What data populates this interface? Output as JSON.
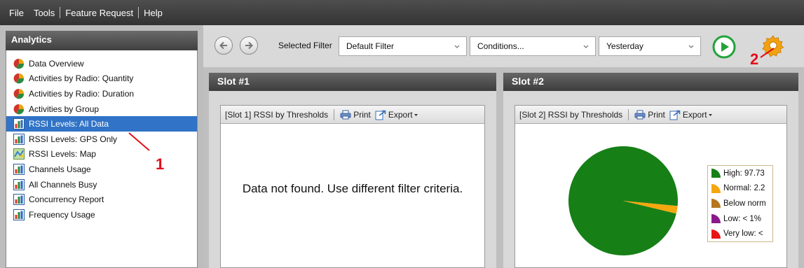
{
  "menubar": {
    "items": [
      "File",
      "Tools",
      "Feature Request",
      "Help"
    ]
  },
  "sidebar": {
    "title": "Analytics",
    "items": [
      {
        "label": "Data Overview",
        "icon": "pie-chart-icon"
      },
      {
        "label": "Activities by Radio: Quantity",
        "icon": "pie-chart-icon"
      },
      {
        "label": "Activities by Radio: Duration",
        "icon": "pie-chart-icon"
      },
      {
        "label": "Activities by Group",
        "icon": "pie-chart-icon"
      },
      {
        "label": "RSSI Levels: All Data",
        "icon": "bar-chart-icon",
        "selected": true
      },
      {
        "label": "RSSI Levels: GPS Only",
        "icon": "bar-chart-icon"
      },
      {
        "label": "RSSI Levels: Map",
        "icon": "map-icon"
      },
      {
        "label": "Channels Usage",
        "icon": "bar-chart-icon"
      },
      {
        "label": "All Channels Busy",
        "icon": "bar-chart-icon"
      },
      {
        "label": "Concurrency Report",
        "icon": "bar-chart-icon"
      },
      {
        "label": "Frequency Usage",
        "icon": "bar-chart-icon"
      }
    ]
  },
  "toolbar": {
    "back_icon": "back-arrow-icon",
    "forward_icon": "forward-arrow-icon",
    "selected_filter_label": "Selected Filter",
    "filter_value": "Default Filter",
    "conditions_value": "Conditions...",
    "date_value": "Yesterday",
    "run_icon": "play-icon",
    "settings_icon": "gear-icon"
  },
  "slots": [
    {
      "header": "Slot #1",
      "panel_title": "[Slot 1] RSSI by Thresholds",
      "print_label": "Print",
      "export_label": "Export",
      "message": "Data not found. Use different filter criteria."
    },
    {
      "header": "Slot #2",
      "panel_title": "[Slot 2] RSSI by Thresholds",
      "print_label": "Print",
      "export_label": "Export",
      "legend": [
        {
          "label": "High: 97.73",
          "color": "#168016"
        },
        {
          "label": "Normal: 2.2",
          "color": "#f5a70e"
        },
        {
          "label": "Below norm",
          "color": "#b5761f"
        },
        {
          "label": "Low: < 1%",
          "color": "#8a1a8c"
        },
        {
          "label": "Very low: <",
          "color": "#e81515"
        }
      ]
    }
  ],
  "chart_data": {
    "type": "pie",
    "categories": [
      "High",
      "Normal",
      "Below normal",
      "Low",
      "Very low"
    ],
    "values": [
      97.73,
      2.27,
      0,
      0,
      0
    ],
    "colors": [
      "#168016",
      "#f5a70e",
      "#b5761f",
      "#8a1a8c",
      "#e81515"
    ]
  },
  "annotations": [
    "1",
    "2"
  ],
  "colors": {
    "selection": "#3173c6",
    "annotation": "#e0101a",
    "run_button": "#22a33a",
    "gear": "#f2a10f"
  }
}
